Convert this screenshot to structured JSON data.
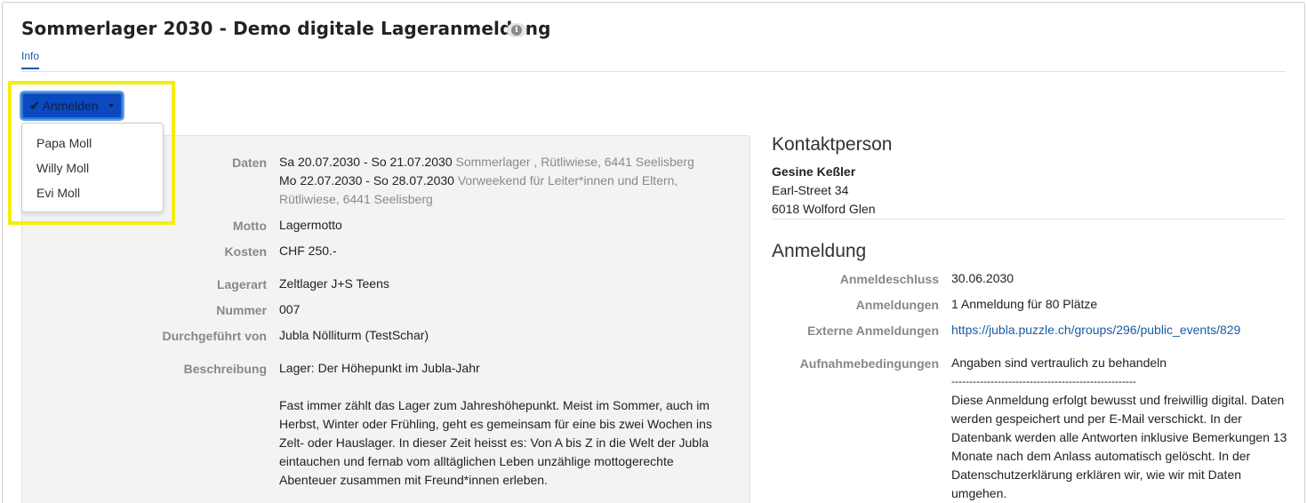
{
  "page": {
    "title": "Sommerlager 2030 - Demo digitale Lageranmeldung",
    "info_icon": "info-circle-icon",
    "tabs": [
      {
        "label": "Info",
        "active": true
      }
    ]
  },
  "register_button": {
    "check_icon": "check-icon",
    "label": "Anmelden",
    "caret_icon": "caret-down-icon"
  },
  "register_menu": {
    "items": [
      {
        "label": "Papa Moll"
      },
      {
        "label": "Willy Moll"
      },
      {
        "label": "Evi Moll"
      }
    ]
  },
  "details": {
    "daten_label": "Daten",
    "dates": [
      {
        "range": "Sa 20.07.2030 - So 21.07.2030",
        "desc": "Sommerlager , Rütliwiese, 6441 Seelisberg"
      },
      {
        "range": "Mo 22.07.2030 - So 28.07.2030",
        "desc": "Vorweekend für Leiter*innen und Eltern,",
        "desc2": "Rütliwiese, 6441 Seelisberg"
      }
    ],
    "motto_label": "Motto",
    "motto": "Lagermotto",
    "kosten_label": "Kosten",
    "kosten": "CHF 250.-",
    "lagerart_label": "Lagerart",
    "lagerart": "Zeltlager J+S Teens",
    "nummer_label": "Nummer",
    "nummer": "007",
    "durchgefuehrt_label": "Durchgeführt von",
    "durchgefuehrt": "Jubla Nölliturm (TestSchar)",
    "beschreibung_label": "Beschreibung",
    "beschreibung_1": "Lager: Der Höhepunkt im Jubla-Jahr",
    "beschreibung_2": "Fast immer zählt das Lager zum Jahreshöhepunkt. Meist im Sommer,  auch im Herbst, Winter oder Frühling, geht es gemeinsam für eine bis zwei Wochen ins Zelt- oder Hauslager. In dieser Zeit heisst es: Von A bis Z in die Welt der Jubla eintauchen und fernab vom alltäglichen Leben unzählige mottogerechte Abenteuer zusammen mit Freund*innen erleben."
  },
  "contact": {
    "heading": "Kontaktperson",
    "name": "Gesine Keßler",
    "street": "Earl-Street 34",
    "city": "6018 Wolford Glen"
  },
  "registration": {
    "heading": "Anmeldung",
    "deadline_label": "Anmeldeschluss",
    "deadline": "30.06.2030",
    "count_label": "Anmeldungen",
    "count": "1 Anmeldung für 80 Plätze",
    "external_label": "Externe Anmeldungen",
    "external_url": "https://jubla.puzzle.ch/groups/296/public_events/829",
    "conditions_label": "Aufnahmebedingungen",
    "conditions_1": "Angaben sind vertraulich zu behandeln",
    "conditions_2": "----------------------------------------------------",
    "conditions_3": "Diese Anmeldung erfolgt bewusst und freiwillig digital. Daten werden gespeichert und per E-Mail verschickt. In der Datenbank werden alle Antworten inklusive Bemerkungen 13 Monate nach dem Anlass automatisch gelöscht. In der Datenschutzerklärung erklären wir, wie wir mit Daten umgehen."
  },
  "colors": {
    "highlight": "#f6ee09",
    "primary": "#0b49c1",
    "link": "#1a5aa8"
  }
}
